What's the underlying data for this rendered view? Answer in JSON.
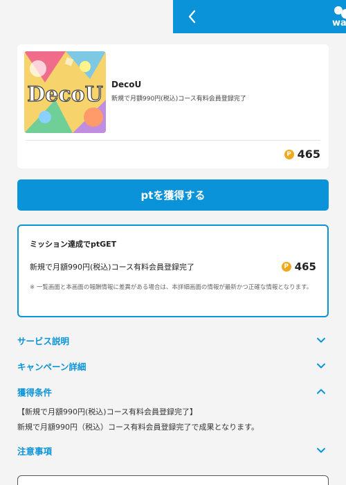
{
  "header": {
    "back_icon": "chevron-left-icon",
    "logo_text": "wa"
  },
  "app": {
    "thumbnail_text": "DecoU",
    "name": "DecoU",
    "description": "新規で月額990円(税込)コース有料会員登録完了",
    "points": "465",
    "coin_symbol": "P"
  },
  "cta": {
    "label": "ptを獲得する"
  },
  "mission": {
    "title": "ミッション達成でptGET",
    "description": "新規で月額990円(税込)コース有料会員登録完了",
    "points": "465",
    "coin_symbol": "P",
    "note": "※ 一覧画面と本画面の報酬情報に差異がある場合は、本詳細画面の情報が最新かつ正確な情報となります。"
  },
  "sections": {
    "service": {
      "title": "サービス説明",
      "state": "collapsed"
    },
    "campaign": {
      "title": "キャンペーン詳細",
      "state": "collapsed"
    },
    "conditions": {
      "title": "獲得条件",
      "state": "expanded",
      "line1": "【新規で月額990円(税込)コース有料会員登録完了】",
      "line2": "新規で月額990円（税込）コース有料会員登録完了で成果となります。"
    },
    "notes": {
      "title": "注意事項",
      "state": "collapsed"
    }
  },
  "colors": {
    "accent": "#0a93d8",
    "coin": "#f3a81c",
    "background": "#f4f4f4"
  }
}
